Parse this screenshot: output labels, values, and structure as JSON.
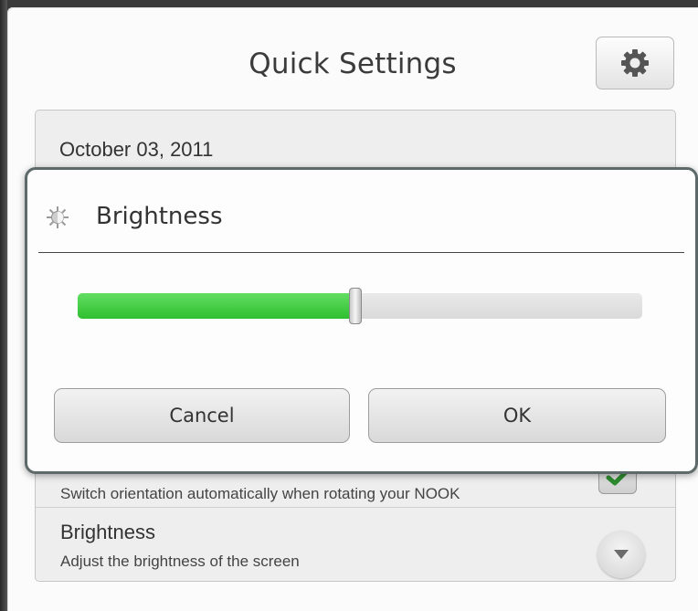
{
  "header": {
    "title": "Quick Settings",
    "settings_icon": "gear-icon"
  },
  "list": {
    "date": "October 03, 2011",
    "orientation": {
      "subtitle": "Switch orientation automatically when rotating your NOOK",
      "checked": true,
      "check_icon": "checkmark-icon"
    },
    "brightness": {
      "title": "Brightness",
      "subtitle": "Adjust the brightness of the screen",
      "expand_icon": "chevron-down-icon"
    }
  },
  "dialog": {
    "icon": "brightness-icon",
    "title": "Brightness",
    "level_percent": 49,
    "cancel_label": "Cancel",
    "ok_label": "OK"
  },
  "colors": {
    "slider_fill": "#3fcc3f",
    "check_green": "#2e8b2e",
    "dialog_border": "#5e6a6a"
  }
}
